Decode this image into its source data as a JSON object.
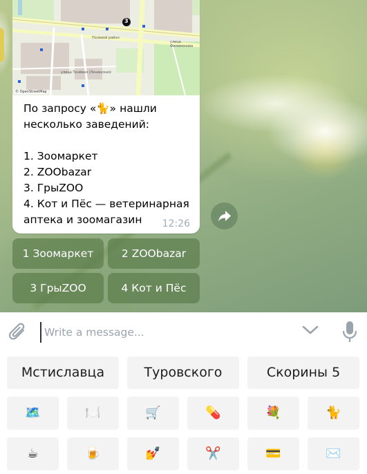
{
  "message": {
    "text": "По запросу «🐈» нашли\nнесколько заведений:\n\n1. Зоомаркет\n2. ZOObazar\n3. ГрыZOO\n4. Кот и Пёс — ветеринарная аптека и зоомагазин",
    "time": "12:26",
    "map": {
      "attribution": "© OpenStreetMap",
      "marker_label": "3",
      "street_labels": [
        "Полевой район",
        "улица Тенёвая (Ленинская)",
        "улица Филимонова"
      ]
    }
  },
  "inline_buttons": [
    "1 Зоомаркет",
    "2 ZOObazar",
    "3 ГрыZOO",
    "4 Кот и Пёс"
  ],
  "input": {
    "placeholder": "Write a message..."
  },
  "keyboard": {
    "row1": [
      "Мстиславца",
      "Туровского",
      "Скорины 5"
    ],
    "row2": [
      "🗺️",
      "🍽️",
      "🛒",
      "💊",
      "💐",
      "🐈"
    ],
    "row3": [
      "☕",
      "🍺",
      "💅",
      "✂️",
      "💳",
      "✉️"
    ]
  },
  "colors": {
    "inline_button_bg": "#55784680",
    "keyboard_button_bg": "#f3f3f3",
    "timestamp": "#a0acb6"
  }
}
